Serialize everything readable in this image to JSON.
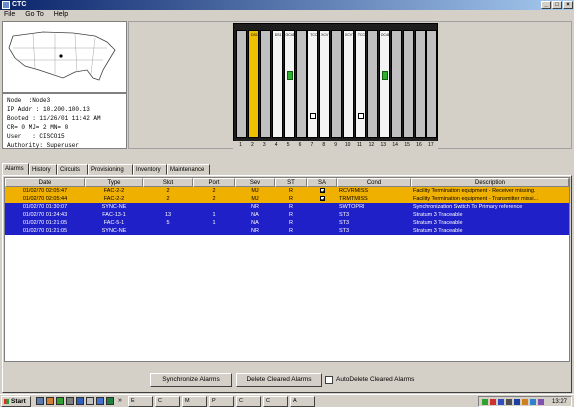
{
  "window": {
    "title": "CTC",
    "minimize": "_",
    "maximize": "□",
    "close": "×"
  },
  "menu": [
    "File",
    "Go To",
    "Help"
  ],
  "node_info": {
    "node": "Node  :Node3",
    "ip": "IP Addr : 10.200.100.13",
    "booted": "Booted : 11/26/01 11:42 AM",
    "counts": "CR= 0 MJ= 2 MN= 0",
    "user": "User   : CISCO15",
    "authority": "Authority: Superuser"
  },
  "shelf": {
    "slots": [
      {
        "num": "1",
        "label": "",
        "type": "empty"
      },
      {
        "num": "2",
        "label": "DS1",
        "type": "yellow"
      },
      {
        "num": "3",
        "label": "",
        "type": "empty"
      },
      {
        "num": "4",
        "label": "DS1",
        "type": "card"
      },
      {
        "num": "5",
        "label": "OC48",
        "type": "card",
        "led": true
      },
      {
        "num": "6",
        "label": "",
        "type": "empty"
      },
      {
        "num": "7",
        "label": "TCC",
        "type": "card",
        "port": true
      },
      {
        "num": "8",
        "label": "XCVT",
        "type": "card"
      },
      {
        "num": "9",
        "label": "",
        "type": "empty"
      },
      {
        "num": "10",
        "label": "XCVT",
        "type": "card"
      },
      {
        "num": "11",
        "label": "TCC",
        "type": "card",
        "port": true
      },
      {
        "num": "12",
        "label": "",
        "type": "empty"
      },
      {
        "num": "13",
        "label": "OC48",
        "type": "card",
        "led": true
      },
      {
        "num": "14",
        "label": "",
        "type": "empty"
      },
      {
        "num": "15",
        "label": "",
        "type": "empty"
      },
      {
        "num": "16",
        "label": "",
        "type": "empty"
      },
      {
        "num": "17",
        "label": "",
        "type": "empty"
      }
    ]
  },
  "tabs": [
    "Alarms",
    "History",
    "Circuits",
    "Provisioning",
    "Inventory",
    "Maintenance"
  ],
  "alarms_table": {
    "columns": [
      "Date",
      "Type",
      "Slot",
      "Port",
      "Sev",
      "ST",
      "SA",
      "Cond",
      "Description"
    ],
    "rows": [
      {
        "date": "01/02/70 02:05:47",
        "type": "FAC-2-2",
        "slot": "2",
        "port": "2",
        "sev": "MJ",
        "st": "R",
        "sa": true,
        "cond": "RCVRMISS",
        "desc": "Facility Termination equipment - Receiver missing.",
        "color": "yellow"
      },
      {
        "date": "01/02/70 02:05:44",
        "type": "FAC-2-2",
        "slot": "2",
        "port": "2",
        "sev": "MJ",
        "st": "R",
        "sa": true,
        "cond": "TRMTMISS",
        "desc": "Facility Termination equipment - Transmitter missi...",
        "color": "yellow"
      },
      {
        "date": "01/02/70 01:30:07",
        "type": "SYNC-NE",
        "slot": "",
        "port": "",
        "sev": "NR",
        "st": "R",
        "sa": false,
        "cond": "SWTOPRI",
        "desc": "Synchronization Switch To Primary reference",
        "color": "blue"
      },
      {
        "date": "01/02/70 01:24:43",
        "type": "FAC-13-1",
        "slot": "13",
        "port": "1",
        "sev": "NA",
        "st": "R",
        "sa": false,
        "cond": "ST3",
        "desc": "Stratum 3 Traceable",
        "color": "blue"
      },
      {
        "date": "01/02/70 01:21:05",
        "type": "FAC-5-1",
        "slot": "5",
        "port": "1",
        "sev": "NA",
        "st": "R",
        "sa": false,
        "cond": "ST3",
        "desc": "Stratum 3 Traceable",
        "color": "blue"
      },
      {
        "date": "01/02/70 01:21:05",
        "type": "SYNC-NE",
        "slot": "",
        "port": "",
        "sev": "NR",
        "st": "R",
        "sa": false,
        "cond": "ST3",
        "desc": "Stratum 3 Traceable",
        "color": "blue"
      }
    ]
  },
  "buttons": {
    "synchronize": "Synchronize Alarms",
    "delete_cleared": "Delete Cleared Alarms",
    "autodelete": "AutoDelete Cleared Alarms"
  },
  "taskbar": {
    "start": "Start",
    "tasks": [
      "»",
      "E",
      "C",
      "M",
      "P",
      "C",
      "C",
      "A"
    ],
    "clock": "13:27"
  },
  "colors": {
    "alarm_major": "#f0b000",
    "alarm_other": "#2020c8",
    "titlebar": "#0a246a"
  }
}
